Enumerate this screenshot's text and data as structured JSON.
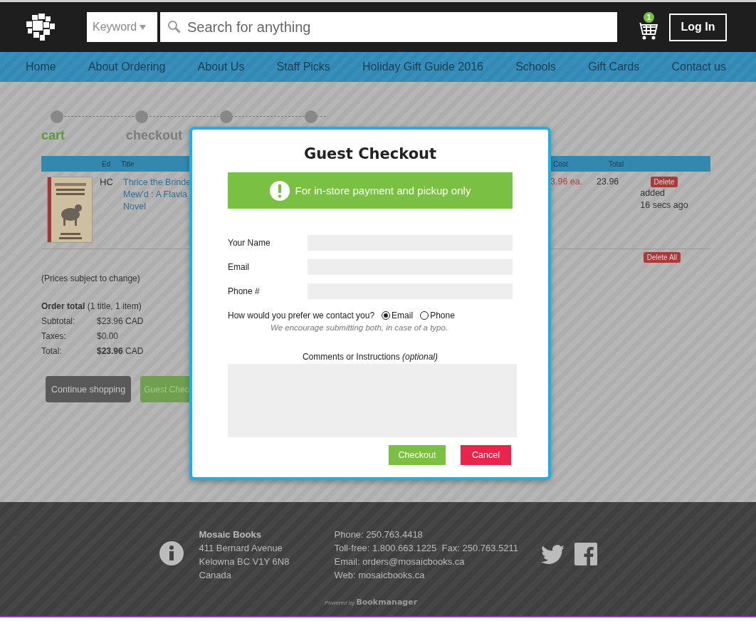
{
  "header": {
    "search_category": "Keyword",
    "search_placeholder": "Search for anything",
    "cart_count": "1",
    "login": "Log In"
  },
  "nav": [
    "Home",
    "About Ordering",
    "About Us",
    "Staff Picks",
    "Holiday Gift Guide 2016",
    "Schools",
    "Gift Cards",
    "Contact us"
  ],
  "steps": [
    {
      "kind": "labeled",
      "label": "cart",
      "selected": true
    },
    {
      "kind": "labeled",
      "label": "checkout",
      "selected": false
    },
    {
      "kind": "dot"
    },
    {
      "kind": "dot"
    }
  ],
  "cart_table": {
    "columns": [
      "Ed",
      "Title",
      "Cost",
      "Total"
    ],
    "rows": [
      {
        "cover": {
          "kind": "picture"
        },
        "ed": "HC",
        "title": [
          "Thrice the Brinde",
          "Mew'd : A Flavia",
          "Novel"
        ],
        "cost": "3.96 ea.",
        "total": "23.96",
        "delete": "Delete",
        "added": [
          "added",
          "16 secs ago"
        ]
      }
    ],
    "delete_all": "Delete All"
  },
  "note": "(Prices subject to change)",
  "order_total": "**Order total** (1 title, 1 item)",
  "summary": [
    {
      "label": "Subtotal:",
      "value": "$23.96 CAD"
    },
    {
      "label": "Taxes:",
      "value": "$0.00"
    },
    {
      "label": "Total:",
      "value": "**$23.96** CAD"
    }
  ],
  "page_buttons": [
    {
      "label": "Continue shopping",
      "kind": "secondary"
    },
    {
      "label": "Guest Chec",
      "kind": "primary"
    }
  ],
  "modal": {
    "title": "Guest Checkout",
    "notice": "For in-store payment and pickup only",
    "fields": [
      "Your Name",
      "Email",
      "Phone #"
    ],
    "contact_question": "How would you prefer we contact you?",
    "contact_options": [
      {
        "label": "Email",
        "selected": true
      },
      {
        "label": "Phone",
        "selected": false
      }
    ],
    "hint": "We encourage submitting both, in case of a typo.",
    "comments_label": "Comments or Instructions *(optional)*",
    "buttons": [
      {
        "label": "Checkout",
        "kind": "primary"
      },
      {
        "label": "Cancel",
        "kind": "danger"
      }
    ]
  },
  "footer": {
    "name": "Mosaic Books",
    "address": [
      "411 Bernard Avenue",
      "Kelowna BC  V1Y 6N8",
      "Canada"
    ],
    "contact": [
      "Phone: 250.763.4418",
      "Toll-free: 1.800.663.1225  Fax: 250.763.5211",
      "Email: orders@mosaicbooks.ca",
      "Web: mosaicbooks.ca"
    ],
    "powered_prefix": "Powered by",
    "powered_brand": "Bookmanager"
  }
}
